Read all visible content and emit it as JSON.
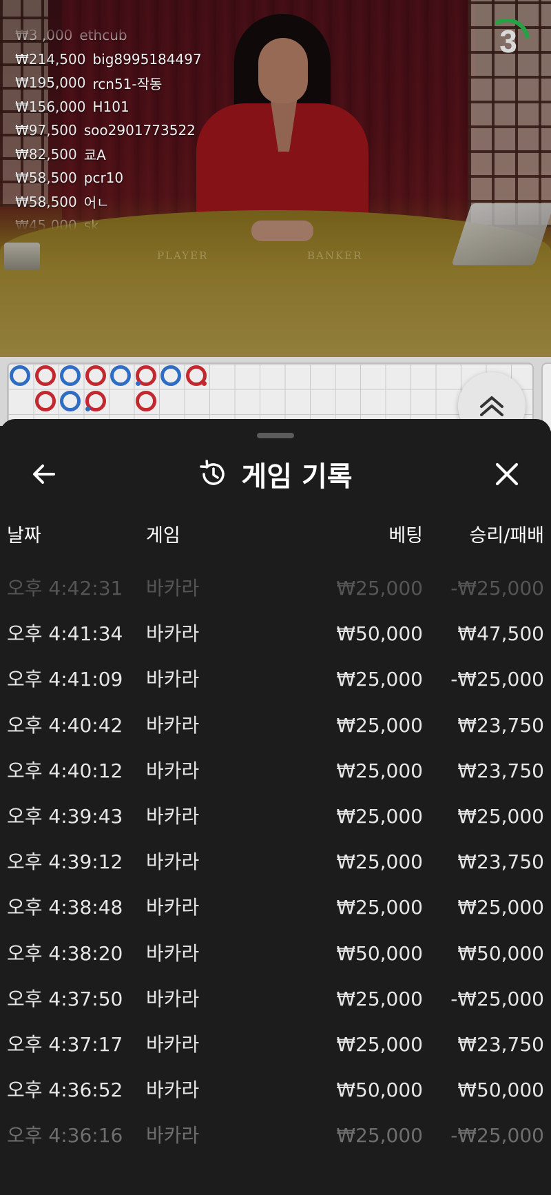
{
  "video": {
    "felt_labels": {
      "player": "PLAYER",
      "banker": "BANKER"
    },
    "countdown": "3",
    "countdown_color": "#25a244",
    "leaderboard": [
      {
        "amount": "₩3 ,000",
        "name": "ethcub"
      },
      {
        "amount": "₩214,500",
        "name": "big8995184497"
      },
      {
        "amount": "₩195,000",
        "name": "rcn51-작동"
      },
      {
        "amount": "₩156,000",
        "name": "H101"
      },
      {
        "amount": "₩97,500",
        "name": "soo2901773522"
      },
      {
        "amount": "₩82,500",
        "name": "쿄A"
      },
      {
        "amount": "₩58,500",
        "name": "pcr10"
      },
      {
        "amount": "₩58,500",
        "name": "어ㄴ"
      },
      {
        "amount": "₩45,000",
        "name": "sk"
      }
    ]
  },
  "scoreboard": {
    "colors": {
      "banker": "#c4282f",
      "player": "#2f6dc4"
    },
    "beads": [
      {
        "col": 0,
        "row": 0,
        "side": "player"
      },
      {
        "col": 1,
        "row": 0,
        "side": "banker"
      },
      {
        "col": 2,
        "row": 0,
        "side": "player"
      },
      {
        "col": 3,
        "row": 0,
        "side": "banker"
      },
      {
        "col": 4,
        "row": 0,
        "side": "player"
      },
      {
        "col": 5,
        "row": 0,
        "side": "banker",
        "dots": [
          "player"
        ]
      },
      {
        "col": 6,
        "row": 0,
        "side": "player"
      },
      {
        "col": 7,
        "row": 0,
        "side": "banker",
        "dots": [
          "banker"
        ]
      },
      {
        "col": 1,
        "row": 1,
        "side": "banker"
      },
      {
        "col": 2,
        "row": 1,
        "side": "player"
      },
      {
        "col": 3,
        "row": 1,
        "side": "banker",
        "dots": [
          "player"
        ]
      },
      {
        "col": 5,
        "row": 1,
        "side": "banker"
      }
    ],
    "expand_icon": "double-chevron-up-icon"
  },
  "sheet": {
    "title": "게임 기록",
    "title_icon": "history-icon",
    "back_icon": "arrow-left-icon",
    "close_icon": "close-icon",
    "columns": {
      "date": "날짜",
      "game": "게임",
      "bet": "베팅",
      "result": "승리/패배"
    },
    "rows": [
      {
        "date": "오후 4:42:31",
        "game": "바카라",
        "bet": "₩25,000",
        "result": "-₩25,000"
      },
      {
        "date": "오후 4:41:34",
        "game": "바카라",
        "bet": "₩50,000",
        "result": "₩47,500"
      },
      {
        "date": "오후 4:41:09",
        "game": "바카라",
        "bet": "₩25,000",
        "result": "-₩25,000"
      },
      {
        "date": "오후 4:40:42",
        "game": "바카라",
        "bet": "₩25,000",
        "result": "₩23,750"
      },
      {
        "date": "오후 4:40:12",
        "game": "바카라",
        "bet": "₩25,000",
        "result": "₩23,750"
      },
      {
        "date": "오후 4:39:43",
        "game": "바카라",
        "bet": "₩25,000",
        "result": "₩25,000"
      },
      {
        "date": "오후 4:39:12",
        "game": "바카라",
        "bet": "₩25,000",
        "result": "₩23,750"
      },
      {
        "date": "오후 4:38:48",
        "game": "바카라",
        "bet": "₩25,000",
        "result": "₩25,000"
      },
      {
        "date": "오후 4:38:20",
        "game": "바카라",
        "bet": "₩50,000",
        "result": "₩50,000"
      },
      {
        "date": "오후 4:37:50",
        "game": "바카라",
        "bet": "₩25,000",
        "result": "-₩25,000"
      },
      {
        "date": "오후 4:37:17",
        "game": "바카라",
        "bet": "₩25,000",
        "result": "₩23,750"
      },
      {
        "date": "오후 4:36:52",
        "game": "바카라",
        "bet": "₩50,000",
        "result": "₩50,000"
      },
      {
        "date": "오후 4:36:16",
        "game": "바카라",
        "bet": "₩25,000",
        "result": "-₩25,000"
      }
    ]
  }
}
